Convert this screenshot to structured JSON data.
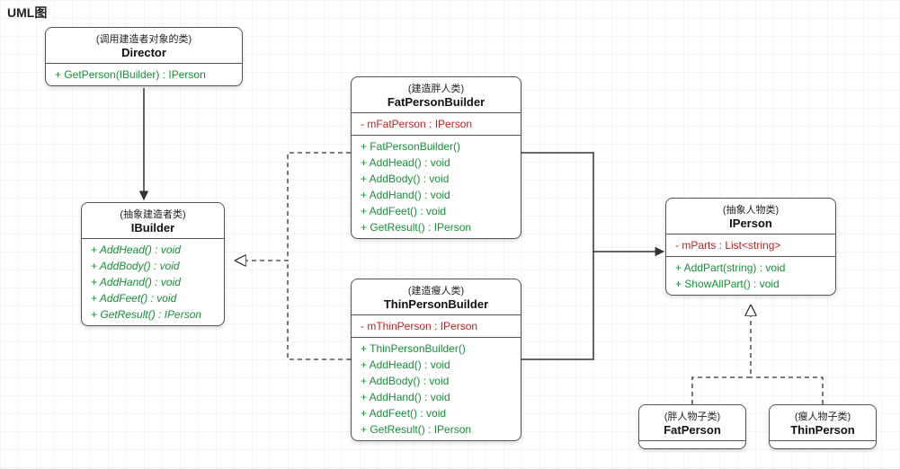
{
  "page_title": "UML图",
  "classes": {
    "director": {
      "stereo": "(调用建造者对象的类)",
      "name": "Director",
      "methods": [
        "+ GetPerson(IBuilder) : IPerson"
      ]
    },
    "ibuilder": {
      "stereo": "(抽象建造者类)",
      "name": "IBuilder",
      "methods": [
        "+ AddHead() : void",
        "+ AddBody() : void",
        "+ AddHand() : void",
        "+ AddFeet() : void",
        "+ GetResult() : IPerson"
      ]
    },
    "fatbuilder": {
      "stereo": "(建造胖人类)",
      "name": "FatPersonBuilder",
      "fields": [
        "- mFatPerson : IPerson"
      ],
      "methods": [
        "+ FatPersonBuilder()",
        "+ AddHead() : void",
        "+ AddBody() : void",
        "+ AddHand() : void",
        "+ AddFeet() : void",
        "+ GetResult() : IPerson"
      ]
    },
    "thinbuilder": {
      "stereo": "(建造瘦人类)",
      "name": "ThinPersonBuilder",
      "fields": [
        "- mThinPerson : IPerson"
      ],
      "methods": [
        "+ ThinPersonBuilder()",
        "+ AddHead() : void",
        "+ AddBody() : void",
        "+ AddHand() : void",
        "+ AddFeet() : void",
        "+ GetResult() : IPerson"
      ]
    },
    "iperson": {
      "stereo": "(抽象人物类)",
      "name": "IPerson",
      "fields": [
        "- mParts : List<string>"
      ],
      "methods": [
        "+ AddPart(string) : void",
        "+ ShowAllPart() : void"
      ]
    },
    "fatperson": {
      "stereo": "(胖人物子类)",
      "name": "FatPerson"
    },
    "thinperson": {
      "stereo": "(瘦人物子类)",
      "name": "ThinPerson"
    }
  },
  "chart_data": {
    "type": "uml_class_diagram",
    "classes": [
      {
        "id": "Director",
        "stereotype": "调用建造者对象的类",
        "methods": [
          "+GetPerson(IBuilder):IPerson"
        ]
      },
      {
        "id": "IBuilder",
        "stereotype": "抽象建造者类",
        "abstract": true,
        "methods": [
          "+AddHead():void",
          "+AddBody():void",
          "+AddHand():void",
          "+AddFeet():void",
          "+GetResult():IPerson"
        ]
      },
      {
        "id": "FatPersonBuilder",
        "stereotype": "建造胖人类",
        "fields": [
          "-mFatPerson:IPerson"
        ],
        "methods": [
          "+FatPersonBuilder()",
          "+AddHead():void",
          "+AddBody():void",
          "+AddHand():void",
          "+AddFeet():void",
          "+GetResult():IPerson"
        ]
      },
      {
        "id": "ThinPersonBuilder",
        "stereotype": "建造瘦人类",
        "fields": [
          "-mThinPerson:IPerson"
        ],
        "methods": [
          "+ThinPersonBuilder()",
          "+AddHead():void",
          "+AddBody():void",
          "+AddHand():void",
          "+AddFeet():void",
          "+GetResult():IPerson"
        ]
      },
      {
        "id": "IPerson",
        "stereotype": "抽象人物类",
        "fields": [
          "-mParts:List<string>"
        ],
        "methods": [
          "+AddPart(string):void",
          "+ShowAllPart():void"
        ]
      },
      {
        "id": "FatPerson",
        "stereotype": "胖人物子类"
      },
      {
        "id": "ThinPerson",
        "stereotype": "瘦人物子类"
      }
    ],
    "relations": [
      {
        "from": "Director",
        "to": "IBuilder",
        "type": "association-solid-arrow"
      },
      {
        "from": "FatPersonBuilder",
        "to": "IBuilder",
        "type": "realization-dashed-hollow"
      },
      {
        "from": "ThinPersonBuilder",
        "to": "IBuilder",
        "type": "realization-dashed-hollow"
      },
      {
        "from": "FatPersonBuilder",
        "to": "IPerson",
        "type": "association-solid-arrow"
      },
      {
        "from": "ThinPersonBuilder",
        "to": "IPerson",
        "type": "association-solid-arrow"
      },
      {
        "from": "FatPerson",
        "to": "IPerson",
        "type": "realization-dashed-hollow"
      },
      {
        "from": "ThinPerson",
        "to": "IPerson",
        "type": "realization-dashed-hollow"
      }
    ]
  }
}
